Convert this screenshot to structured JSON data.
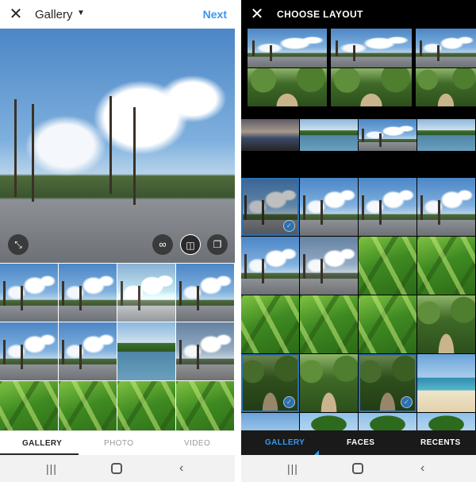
{
  "left": {
    "header": {
      "close_icon": "close-icon",
      "title": "Gallery",
      "caret_icon": "dropdown-caret-icon",
      "next_label": "Next",
      "accent_color": "#3897f0"
    },
    "preview": {
      "tools": [
        {
          "name": "expand-icon",
          "glyph": "⤡"
        },
        {
          "name": "boomerang-icon",
          "glyph": "∞"
        },
        {
          "name": "layout-icon",
          "glyph": "◫"
        },
        {
          "name": "select-multiple-icon",
          "glyph": "❐"
        }
      ]
    },
    "tabs": [
      {
        "label": "GALLERY",
        "active": true
      },
      {
        "label": "PHOTO",
        "active": false
      },
      {
        "label": "VIDEO",
        "active": false
      }
    ]
  },
  "right": {
    "header": {
      "close_icon": "close-icon",
      "title": "CHOOSE LAYOUT"
    },
    "tabs": [
      {
        "label": "GALLERY",
        "active": true
      },
      {
        "label": "FACES",
        "active": false
      },
      {
        "label": "RECENTS",
        "active": false
      }
    ],
    "selected_count": 3,
    "check_glyph": "✓"
  },
  "system_nav": {
    "recent_apps_glyph": "|||",
    "back_glyph": "‹"
  }
}
